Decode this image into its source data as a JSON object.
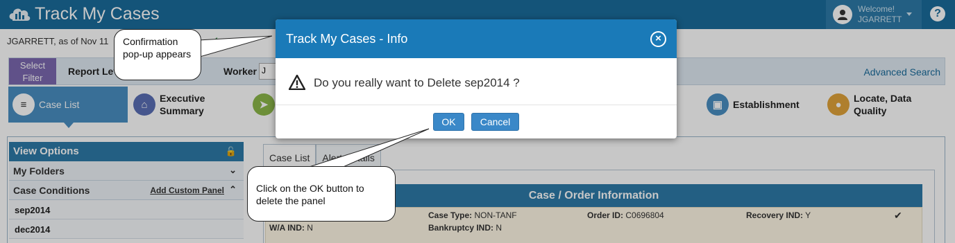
{
  "header": {
    "app_title": "Track My Cases",
    "welcome": "Welcome!",
    "username": "JGARRETT",
    "help": "?"
  },
  "subheader": {
    "as_of_text": "JGARRETT, as of Nov 11",
    "link_fragment": "as of",
    "link_fragment2": "ctiv"
  },
  "filter": {
    "select_filter": "Select Filter",
    "report_level": "Report Lev",
    "worker_label": "Worker",
    "worker_value": "J",
    "advanced_search": "Advanced Search"
  },
  "nav": {
    "items": [
      {
        "label": "Case List"
      },
      {
        "label": "Executive Summary"
      },
      {
        "label": ""
      },
      {
        "label": "Establishment"
      },
      {
        "label": "Locate, Data Quality"
      }
    ]
  },
  "sidebar": {
    "view_options": "View Options",
    "my_folders": "My Folders",
    "case_conditions": "Case Conditions",
    "add_custom_panel": "Add Custom Panel",
    "folders": [
      "sep2014",
      "dec2014"
    ]
  },
  "tabs": [
    "Case List",
    "Alert Details"
  ],
  "panel": {
    "title": "Case / Order Information",
    "fields": [
      {
        "label": "Case Type:",
        "value": " NON-TANF"
      },
      {
        "label": "Order ID:",
        "value": " C0696804"
      },
      {
        "label": "Recovery IND:",
        "value": " Y"
      },
      {
        "label": "W/A IND:",
        "value": " N"
      },
      {
        "label": "Bankruptcy IND:",
        "value": " N"
      }
    ]
  },
  "modal": {
    "title": "Track My Cases - Info",
    "message": "Do you really want to Delete sep2014 ?",
    "ok": "OK",
    "cancel": "Cancel"
  },
  "callouts": {
    "confirmation": "Confirmation pop-up appears",
    "click_ok": "Click on the OK button to delete the panel"
  },
  "colors": {
    "header_blue": "#1a6c9c",
    "modal_header": "#1a7ab8",
    "button_blue": "#3a88c8",
    "filter_purple": "#7b68b0"
  }
}
